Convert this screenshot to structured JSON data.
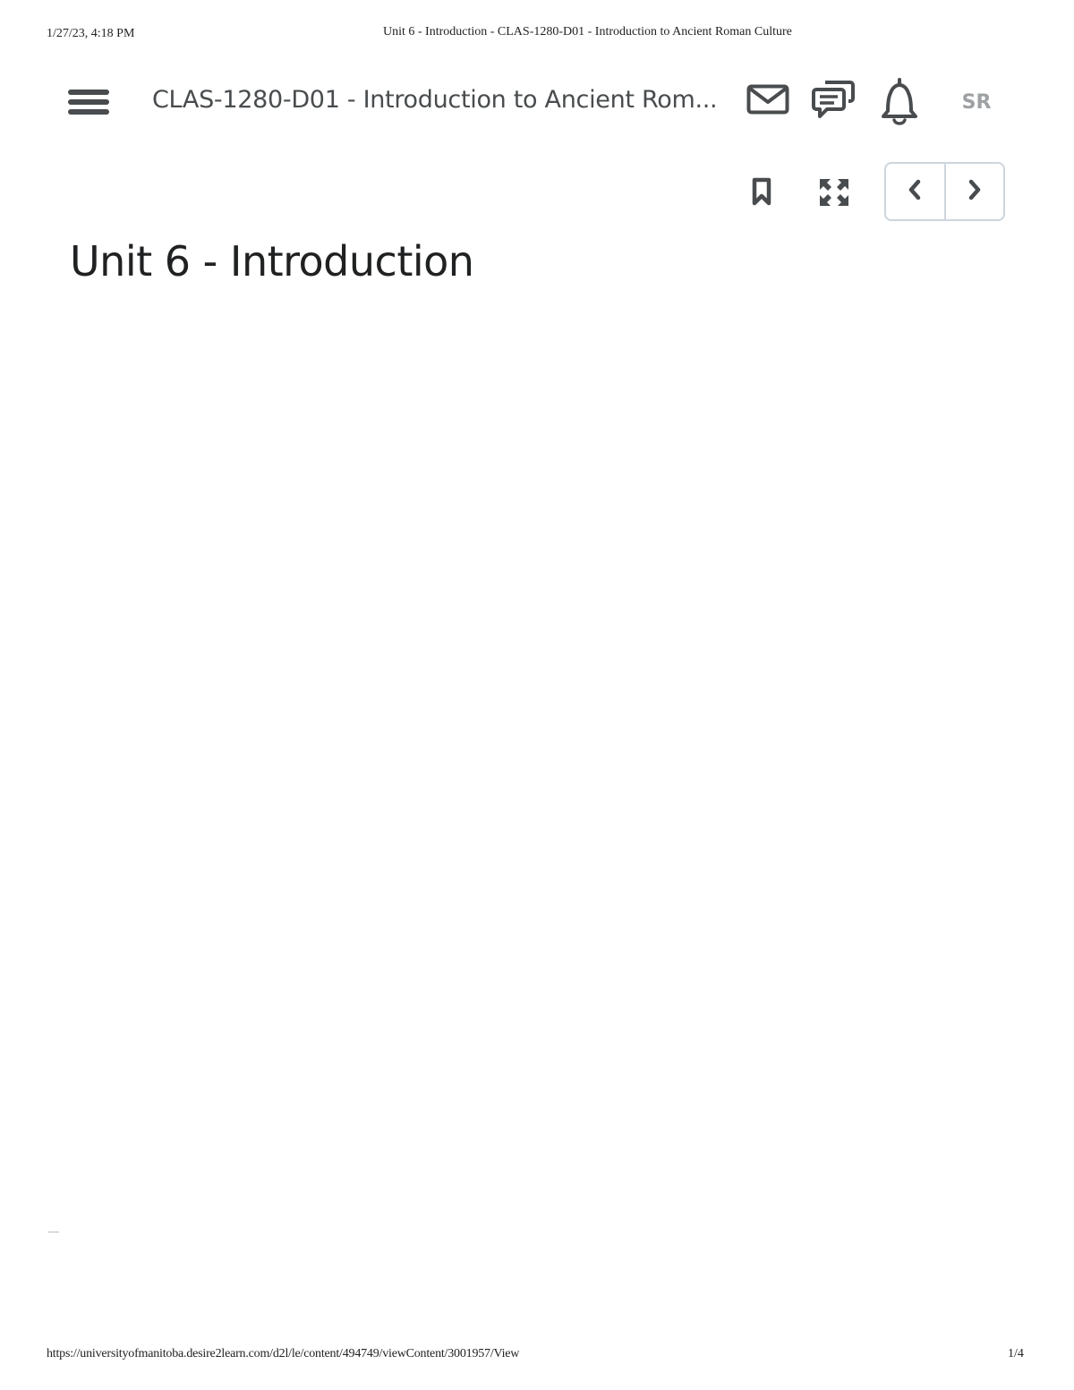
{
  "print_header": {
    "datetime": "1/27/23, 4:18 PM",
    "document_title": "Unit 6 - Introduction - CLAS-1280-D01 - Introduction to Ancient Roman Culture"
  },
  "navbar": {
    "menu_icon": "hamburger-menu-icon",
    "course_title": "CLAS-1280-D01 - Introduction to Ancient Rom...",
    "icons": [
      "mail-icon",
      "chat-icon",
      "bell-icon"
    ],
    "avatar_initials": "SR"
  },
  "toolbar": {
    "icons": [
      "bookmark-icon",
      "fullscreen-icon",
      "chevron-left-icon",
      "chevron-right-icon"
    ]
  },
  "content": {
    "page_title": "Unit 6 - Introduction"
  },
  "print_footer": {
    "url": "https://universityofmanitoba.desire2learn.com/d2l/le/content/494749/viewContent/3001957/View",
    "page_number": "1/4"
  },
  "colors": {
    "icon": "#494c4e",
    "avatar_text": "#9ea1a4",
    "pager_border": "#cdd5dc",
    "title": "#202122"
  }
}
